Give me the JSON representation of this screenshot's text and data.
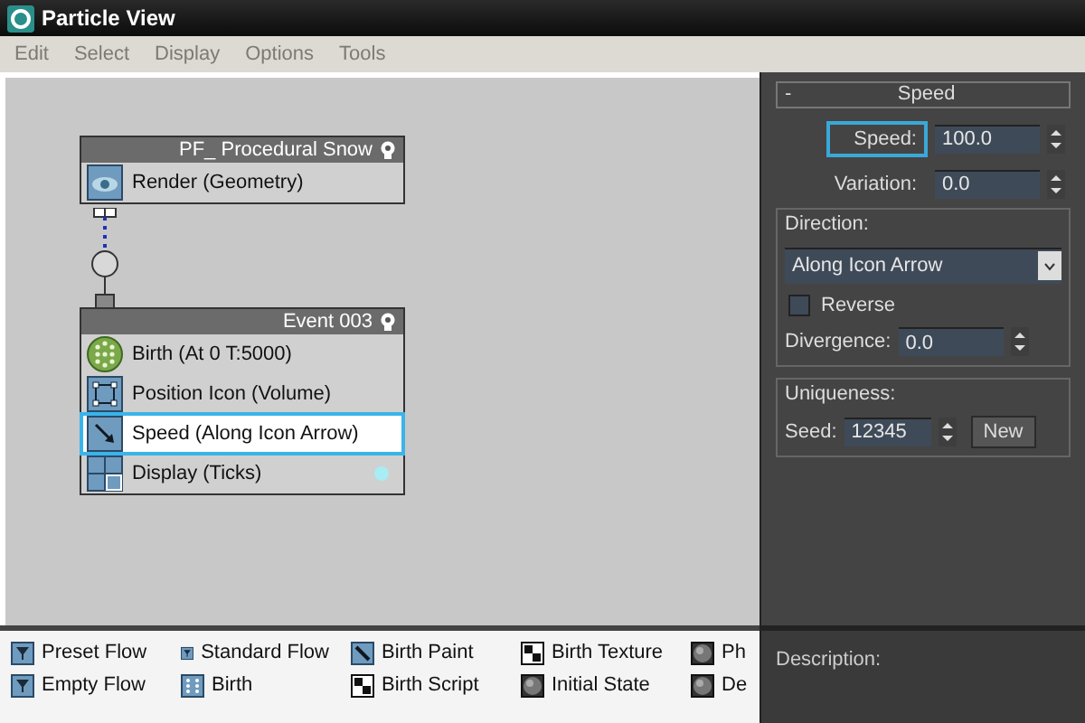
{
  "window": {
    "title": "Particle View"
  },
  "menu": [
    {
      "label": "Edit",
      "disabled": true
    },
    {
      "label": "Select",
      "disabled": true
    },
    {
      "label": "Display",
      "disabled": true
    },
    {
      "label": "Options",
      "disabled": true
    },
    {
      "label": "Tools",
      "disabled": true
    }
  ],
  "events": [
    {
      "title": "PF_ Procedural Snow",
      "operators": [
        {
          "label": "Render (Geometry)",
          "kind": "render",
          "selected": false
        }
      ]
    },
    {
      "title": "Event 003",
      "operators": [
        {
          "label": "Birth  (At 0 T:5000)",
          "kind": "birth",
          "selected": false
        },
        {
          "label": "Position Icon (Volume)",
          "kind": "position",
          "selected": false
        },
        {
          "label": "Speed  (Along Icon Arrow)",
          "kind": "speed",
          "selected": true
        },
        {
          "label": "Display  (Ticks)",
          "kind": "display",
          "selected": false,
          "color": "#a8ecf4"
        }
      ]
    }
  ],
  "rollout": {
    "collapse": "-",
    "title": "Speed",
    "fields": [
      {
        "label": "Speed:",
        "value": "100.0",
        "focused": true
      },
      {
        "label": "Variation:",
        "value": "0.0",
        "focused": false
      }
    ],
    "direction": {
      "title": "Direction:",
      "dropdown": "Along Icon Arrow",
      "reverse": {
        "label": "Reverse",
        "checked": false
      },
      "divergence": {
        "label": "Divergence:",
        "value": "0.0"
      }
    },
    "uniqueness": {
      "title": "Uniqueness:",
      "seed": {
        "label": "Seed:",
        "value": "12345"
      },
      "button": "New"
    }
  },
  "depot": [
    {
      "label": "Preset Flow",
      "kind": "flow"
    },
    {
      "label": "Empty Flow",
      "kind": "flow"
    },
    {
      "label": "Standard Flow",
      "kind": "flow"
    },
    {
      "label": "Birth",
      "kind": "birth"
    },
    {
      "label": "Birth Paint",
      "kind": "paint"
    },
    {
      "label": "Birth Script",
      "kind": "checker"
    },
    {
      "label": "Birth Texture",
      "kind": "checker"
    },
    {
      "label": "Initial State",
      "kind": "sphere"
    },
    {
      "label": "Ph",
      "kind": "sphere"
    },
    {
      "label": "De",
      "kind": "sphere"
    }
  ],
  "description": {
    "label": "Description:"
  }
}
